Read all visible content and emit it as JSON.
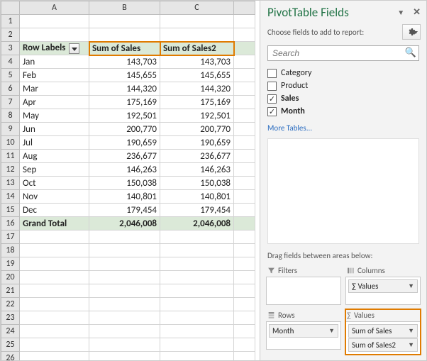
{
  "columns": [
    "A",
    "B",
    "C"
  ],
  "pivot": {
    "row_labels_header": "Row Labels",
    "col_headers": [
      "Sum of Sales",
      "Sum of Sales2"
    ],
    "rows": [
      {
        "label": "Jan",
        "v1": "143,703",
        "v2": "143,703"
      },
      {
        "label": "Feb",
        "v1": "145,655",
        "v2": "145,655"
      },
      {
        "label": "Mar",
        "v1": "144,320",
        "v2": "144,320"
      },
      {
        "label": "Apr",
        "v1": "175,169",
        "v2": "175,169"
      },
      {
        "label": "May",
        "v1": "192,501",
        "v2": "192,501"
      },
      {
        "label": "Jun",
        "v1": "200,770",
        "v2": "200,770"
      },
      {
        "label": "Jul",
        "v1": "190,659",
        "v2": "190,659"
      },
      {
        "label": "Aug",
        "v1": "236,677",
        "v2": "236,677"
      },
      {
        "label": "Sep",
        "v1": "146,263",
        "v2": "146,263"
      },
      {
        "label": "Oct",
        "v1": "150,038",
        "v2": "150,038"
      },
      {
        "label": "Nov",
        "v1": "140,801",
        "v2": "140,801"
      },
      {
        "label": "Dec",
        "v1": "179,454",
        "v2": "179,454"
      }
    ],
    "grand_total_label": "Grand Total",
    "grand_total_v1": "2,046,008",
    "grand_total_v2": "2,046,008"
  },
  "pane": {
    "title": "PivotTable Fields",
    "subtitle": "Choose fields to add to report:",
    "search_placeholder": "Search",
    "fields": [
      {
        "name": "Category",
        "checked": false,
        "bold": false
      },
      {
        "name": "Product",
        "checked": false,
        "bold": false
      },
      {
        "name": "Sales",
        "checked": true,
        "bold": true
      },
      {
        "name": "Month",
        "checked": true,
        "bold": true
      }
    ],
    "more": "More Tables...",
    "drag_text": "Drag fields between areas below:",
    "areas": {
      "filters_label": "Filters",
      "columns_label": "Columns",
      "rows_label": "Rows",
      "values_label": "Values",
      "columns_chip": "∑ Values",
      "rows_chip": "Month",
      "values_chips": [
        "Sum of Sales",
        "Sum of Sales2"
      ]
    }
  }
}
